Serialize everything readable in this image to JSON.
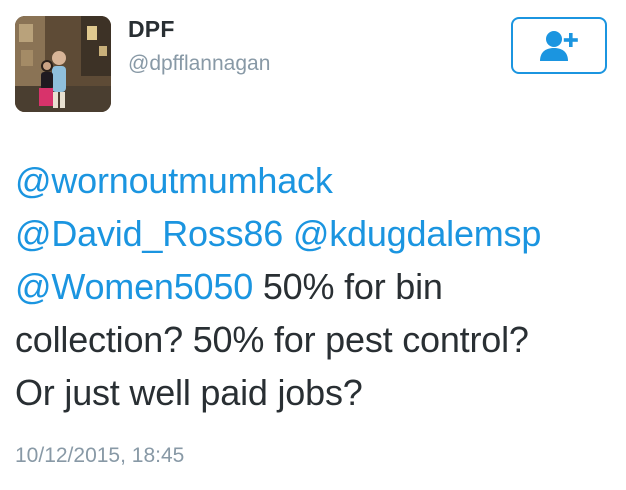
{
  "user": {
    "display_name": "DPF",
    "handle": "@dpfflannagan",
    "avatar": "profile-photo"
  },
  "follow_button": {
    "icon": "add-user-icon",
    "color": "#1b95e0"
  },
  "tweet": {
    "mention1": "@wornoutmumhack",
    "mention2": "@David_Ross86",
    "mention3": "@kdugdalemsp",
    "mention4": "@Women5050",
    "text_line3": " 50% for bin",
    "text_line4": "collection?  50% for pest control?",
    "text_line5": "Or just well paid jobs?",
    "timestamp": "10/12/2015, 18:45"
  },
  "colors": {
    "link": "#1b95e0",
    "text": "#292f33",
    "secondary": "#8899a6"
  }
}
